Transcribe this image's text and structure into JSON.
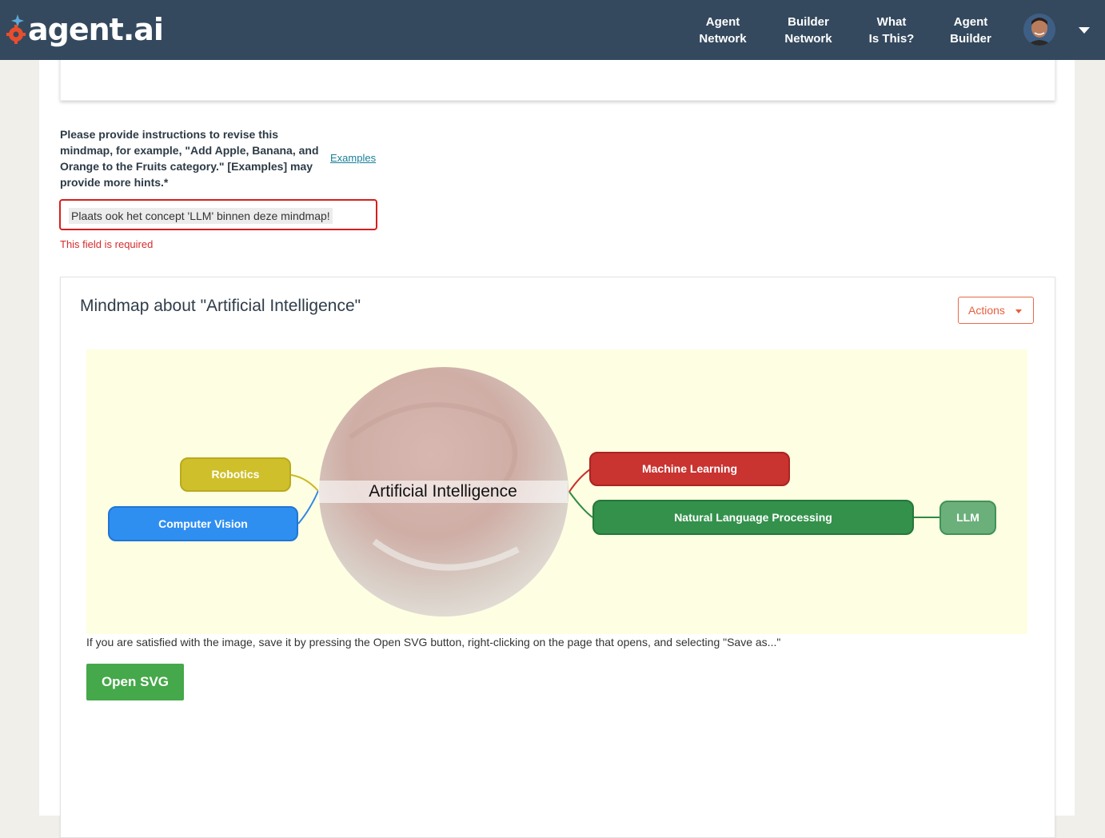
{
  "header": {
    "logo_text": "agent.ai",
    "nav": [
      {
        "line1": "Agent",
        "line2": "Network"
      },
      {
        "line1": "Builder",
        "line2": "Network"
      },
      {
        "line1": "What",
        "line2": "Is This?"
      },
      {
        "line1": "Agent",
        "line2": "Builder"
      }
    ],
    "colors": {
      "bar": "#34495e",
      "logo_accent": "#e84e2c"
    }
  },
  "form": {
    "instruction_label": "Please provide instructions to revise this mindmap, for example, \"Add Apple, Banana, and Orange to the Fruits category.\" [Examples] may provide more hints.*",
    "examples_link": "Examples",
    "input_value": "Plaats ook het concept 'LLM' binnen deze mindmap!",
    "error": "This field is required"
  },
  "mindmap_card": {
    "title": "Mindmap about \"Artificial Intelligence\"",
    "actions_label": "Actions",
    "center": "Artificial Intelligence",
    "nodes": {
      "robotics": "Robotics",
      "computer_vision": "Computer Vision",
      "machine_learning": "Machine Learning",
      "nlp": "Natural Language Processing",
      "llm": "LLM"
    },
    "note": "If you are satisfied with the image, save it by pressing the Open SVG button, right-clicking on the page that opens, and selecting \"Save as...\"",
    "open_svg_label": "Open SVG"
  }
}
